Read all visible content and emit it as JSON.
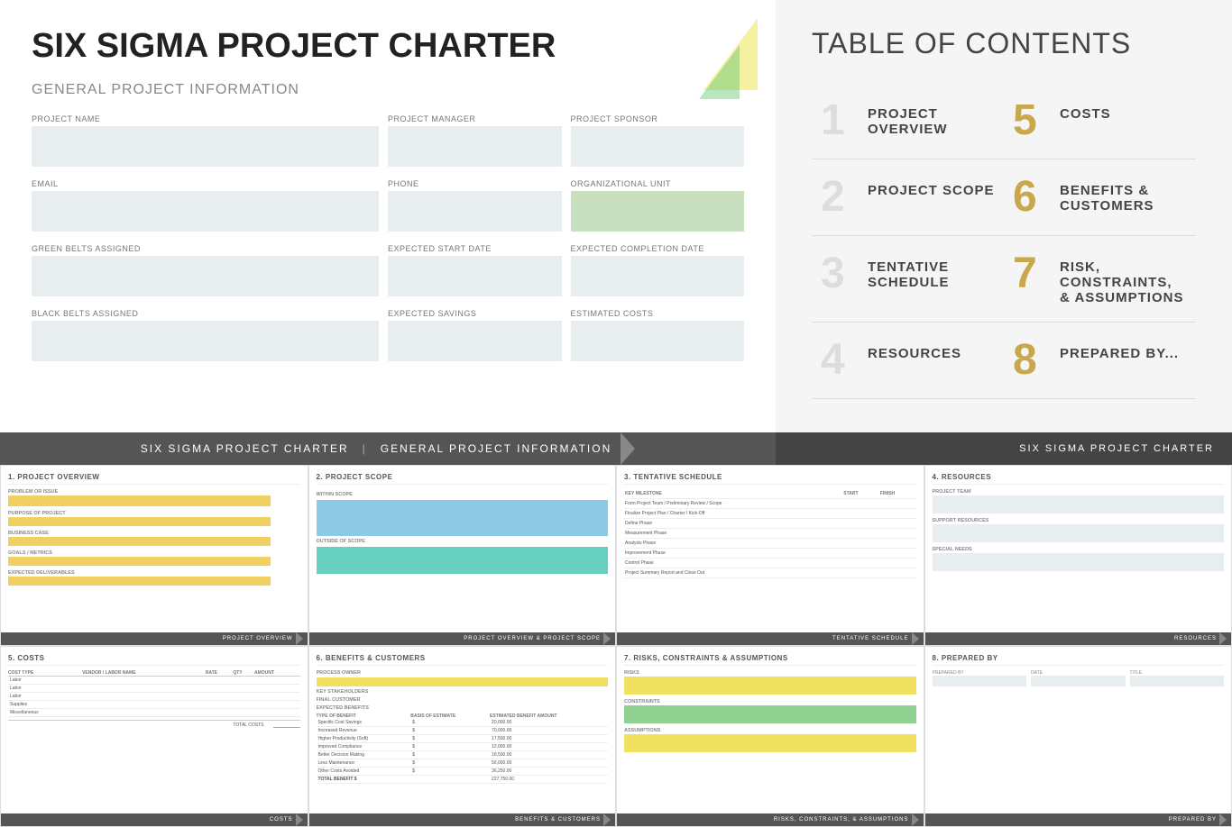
{
  "header": {
    "title": "SIX SIGMA PROJECT CHARTER",
    "section": "GENERAL PROJECT INFORMATION"
  },
  "form": {
    "fields": [
      {
        "label": "PROJECT NAME",
        "wide": true
      },
      {
        "label": "PROJECT MANAGER",
        "wide": false
      },
      {
        "label": "PROJECT SPONSOR",
        "wide": false
      }
    ],
    "row2": [
      {
        "label": "EMAIL",
        "wide": true
      },
      {
        "label": "PHONE",
        "wide": false
      },
      {
        "label": "ORGANIZATIONAL UNIT",
        "wide": false
      }
    ],
    "row3": [
      {
        "label": "GREEN BELTS ASSIGNED",
        "wide": true
      },
      {
        "label": "EXPECTED START DATE",
        "wide": false
      },
      {
        "label": "EXPECTED COMPLETION DATE",
        "wide": false
      }
    ],
    "row4": [
      {
        "label": "BLACK BELTS ASSIGNED",
        "wide": true
      },
      {
        "label": "EXPECTED SAVINGS",
        "wide": false
      },
      {
        "label": "ESTIMATED COSTS",
        "wide": false
      }
    ]
  },
  "toc": {
    "title": "TABLE OF CONTENTS",
    "items": [
      {
        "number": "1",
        "label": "PROJECT OVERVIEW",
        "gold": false
      },
      {
        "number": "5",
        "label": "COSTS",
        "gold": true
      },
      {
        "number": "2",
        "label": "PROJECT SCOPE",
        "gold": false
      },
      {
        "number": "6",
        "label": "BENEFITS & CUSTOMERS",
        "gold": true
      },
      {
        "number": "3",
        "label": "TENTATIVE SCHEDULE",
        "gold": false
      },
      {
        "number": "7",
        "label": "RISK, CONSTRAINTS, & ASSUMPTIONS",
        "gold": true
      },
      {
        "number": "4",
        "label": "RESOURCES",
        "gold": false
      },
      {
        "number": "8",
        "label": "PREPARED BY...",
        "gold": true
      }
    ]
  },
  "separator": {
    "left": "SIX SIGMA PROJECT CHARTER   |   GENERAL PROJECT INFORMATION",
    "right": "SIX SIGMA PROJECT CHARTER"
  },
  "panels": {
    "project_overview": {
      "title": "1. PROJECT OVERVIEW",
      "items": [
        "PROBLEM OR ISSUE",
        "PURPOSE OF PROJECT",
        "BUSINESS CASE",
        "GOALS / METRICS",
        "EXPECTED DELIVERABLES"
      ],
      "footer": "PROJECT OVERVIEW"
    },
    "project_scope": {
      "title": "2. PROJECT SCOPE",
      "within": "WITHIN SCOPE",
      "outside": "OUTSIDE OF SCOPE",
      "footer": "PROJECT OVERVIEW & PROJECT SCOPE"
    },
    "tentative_schedule": {
      "title": "3. TENTATIVE SCHEDULE",
      "headers": [
        "KEY MILESTONE",
        "START",
        "FINISH"
      ],
      "rows": [
        "Form Project Team / Preliminary Review / Scope",
        "Finalize Project Plan / Charter / Kick-Off",
        "Define Phase",
        "Measurement Phase",
        "Analysis Phase",
        "Improvement Phase",
        "Control Phase",
        "Project Summary Report and Close Out"
      ],
      "footer": "TENTATIVE SCHEDULE"
    },
    "resources": {
      "title": "4. RESOURCES",
      "items": [
        "PROJECT TEAM",
        "SUPPORT RESOURCES",
        "SPECIAL NEEDS"
      ],
      "footer": "RESOURCES"
    },
    "costs": {
      "title": "5. COSTS",
      "headers": [
        "COST TYPE",
        "VENDOR / LABOR NAME",
        "RATE",
        "QTY",
        "AMOUNT"
      ],
      "rows": [
        "Labor",
        "Labor",
        "Labor",
        "Supplies",
        "Miscellaneous"
      ],
      "total_label": "TOTAL COSTS",
      "footer": "COSTS"
    },
    "benefits": {
      "title": "6. BENEFITS & CUSTOMERS",
      "sections": [
        "PROCESS OWNER",
        "KEY STAKEHOLDERS",
        "FINAL CUSTOMER",
        "EXPECTED BENEFITS"
      ],
      "benefit_headers": [
        "TYPE OF BENEFIT",
        "BASIS OF ESTIMATE",
        "ESTIMATED BENEFIT AMOUNT"
      ],
      "benefit_rows": [
        {
          "type": "Specific Cost Savings",
          "amount": "$ 20,000.00"
        },
        {
          "type": "Increased Revenue",
          "amount": "$ 70,000.00"
        },
        {
          "type": "Higher Productivity (Soft)",
          "amount": "$ 17,500.00"
        },
        {
          "type": "Improved Compliance",
          "amount": "$ 12,000.00"
        },
        {
          "type": "Better Decision Making",
          "amount": "$ 18,500.00"
        },
        {
          "type": "Less Maintenance",
          "amount": "$ 56,000.00"
        },
        {
          "type": "Other Costs Avoided",
          "amount": "$ 36,250.00"
        }
      ],
      "total_label": "TOTAL BENEFIT $",
      "total_value": "227,750.00",
      "footer": "BENEFITS & CUSTOMERS"
    },
    "risks": {
      "title": "7. RISKS, CONSTRAINTS & ASSUMPTIONS",
      "items": [
        "RISKS",
        "CONSTRAINTS",
        "ASSUMPTIONS"
      ],
      "footer": "RISKS, CONSTRAINTS, & ASSUMPTIONS"
    },
    "prepared_by": {
      "title": "8. PREPARED BY",
      "fields": [
        "PREPARED BY",
        "DATE",
        "TITLE"
      ],
      "footer": "PREPARED BY"
    }
  }
}
